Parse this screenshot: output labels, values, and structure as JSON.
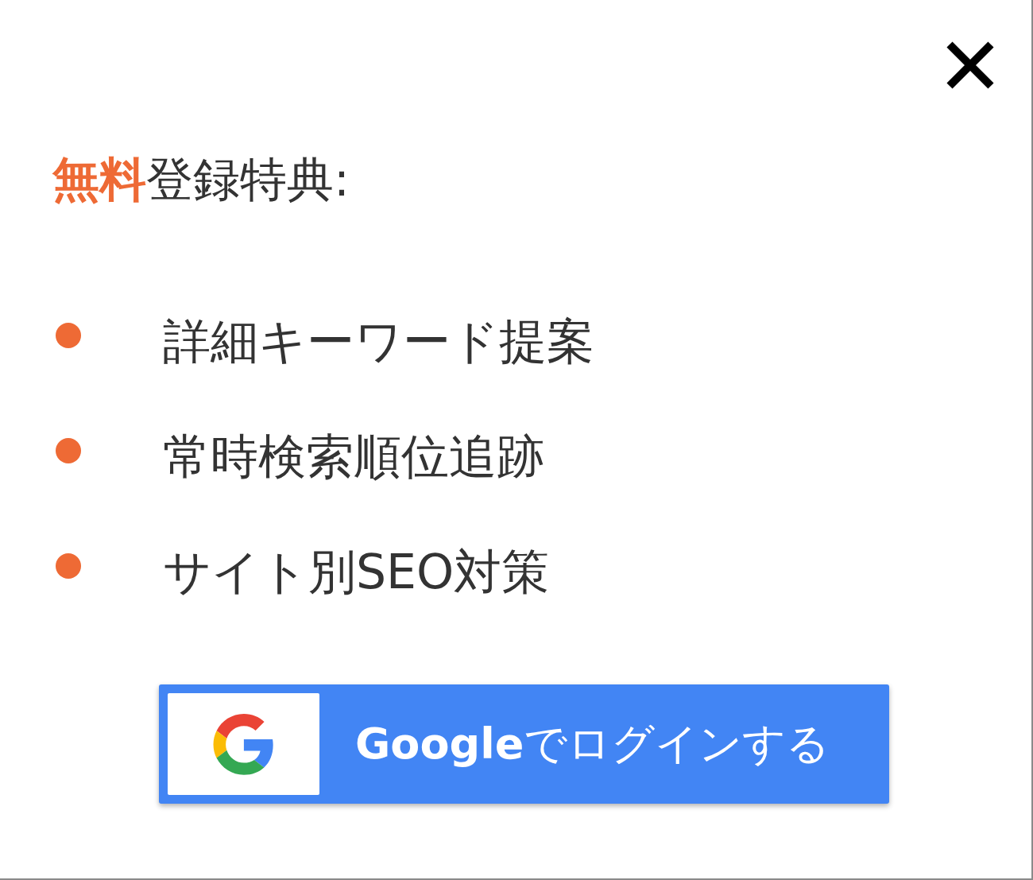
{
  "dialog": {
    "title": "**無料**登録特典:",
    "benefits": [
      "詳細キーワード提案",
      "常時検索順位追跡",
      "サイト別SEO対策"
    ],
    "login_button": {
      "label": "**Google**でログインする"
    }
  }
}
